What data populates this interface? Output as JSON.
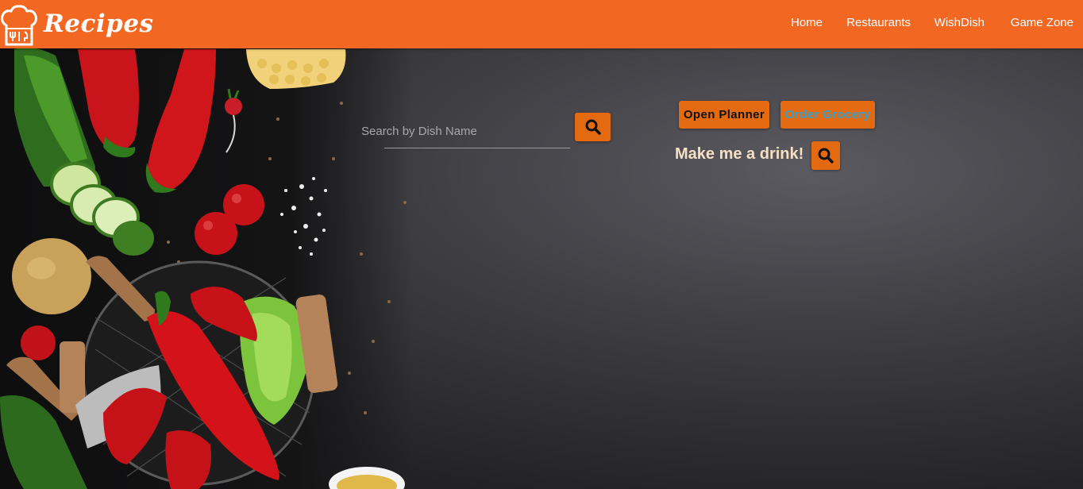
{
  "brand": {
    "name": "Recipes",
    "icon": "chef-hat-icon"
  },
  "nav": {
    "items": [
      "Home",
      "Restaurants",
      "WishDish",
      "Game Zone"
    ]
  },
  "search": {
    "placeholder": "Search by Dish Name",
    "value": "",
    "button_icon": "search-icon"
  },
  "actions": {
    "planner_label": "Open Planner",
    "grocery_label": "Order Grocery"
  },
  "drink": {
    "label": "Make me a drink!",
    "button_icon": "search-icon"
  },
  "colors": {
    "navbar": "#f26722",
    "button": "#e36a10",
    "grocery_text": "#2fa0d0",
    "planner_text": "#111111",
    "drink_label": "#f7dfc4"
  }
}
